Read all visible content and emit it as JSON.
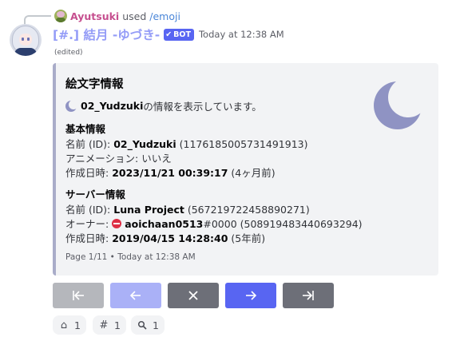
{
  "reply": {
    "user": "Ayutsuki",
    "used": "used",
    "command": "/emoji"
  },
  "message": {
    "author": "[#.] 結月 -ゆづき-",
    "bot_tag": "BOT",
    "timestamp": "Today at 12:38 AM",
    "edited": "(edited)"
  },
  "embed": {
    "title": "絵文字情報",
    "desc_name": "02_Yudzuki",
    "desc_rest": " の情報を表示しています。",
    "basic": {
      "heading": "基本情報",
      "name_label": "名前 (ID): ",
      "name_value": "02_Yudzuki",
      "name_id": " (1176185005731491913)",
      "anim_label": "アニメーション: ",
      "anim_value": "いいえ",
      "created_label": "作成日時: ",
      "created_value": "2023/11/21 00:39:17",
      "created_rel": " (4ヶ月前)"
    },
    "server": {
      "heading": "サーバー情報",
      "name_label": "名前 (ID): ",
      "name_value": "Luna Project",
      "name_id": " (567219722458890271)",
      "owner_label": "オーナー: ",
      "owner_value": "aoichaan0513",
      "owner_tag": "#0000",
      "owner_id": " (508919483440693294)",
      "created_label": "作成日時: ",
      "created_value": "2019/04/15 14:28:40",
      "created_rel": " (5年前)"
    },
    "footer": "Page 1/11 • Today at 12:38 AM",
    "accent_color": "#a9acc9",
    "moon_color": "#8f93c3"
  },
  "buttons": [
    {
      "icon": "first-page-icon",
      "state": "disabled"
    },
    {
      "icon": "arrow-left-icon",
      "state": "disabled"
    },
    {
      "icon": "close-icon",
      "state": "enabled"
    },
    {
      "icon": "arrow-right-icon",
      "state": "enabled"
    },
    {
      "icon": "last-page-icon",
      "state": "enabled"
    }
  ],
  "reactions": [
    {
      "icon": "house-icon",
      "count": "1"
    },
    {
      "icon": "hash-icon",
      "count": "1"
    },
    {
      "icon": "magnifier-icon",
      "count": "1"
    }
  ],
  "colors": {
    "bot_name": "#949cf7",
    "reply_user": "#c64f8f",
    "command": "#4a86d8",
    "blurple": "#5865f2"
  }
}
